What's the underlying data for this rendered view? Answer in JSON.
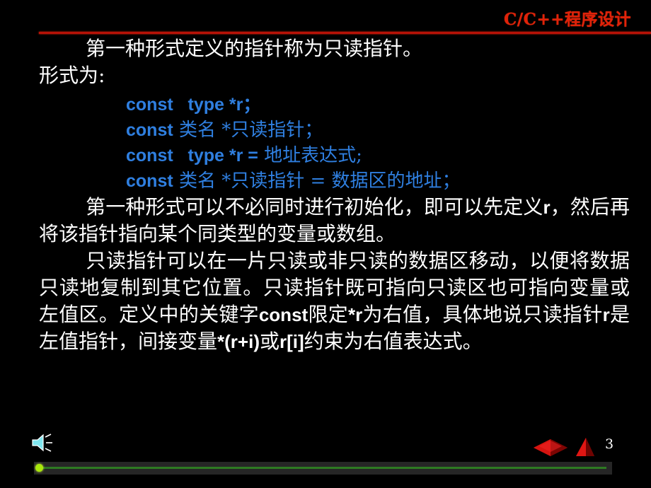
{
  "header": {
    "title": "C/C++程序设计",
    "accent_color": "#e02209",
    "rule_color": "#b81207"
  },
  "content": {
    "paragraph_1": "第一种形式定义的指针称为只读指针。",
    "label_form": "形式为:",
    "code": {
      "accent_color": "#2f7fe0",
      "lines": [
        {
          "keyword": "const",
          "type_kw": "type",
          "rest": " *r；",
          "id": "code-line-1",
          "full": "const   type  *r；"
        },
        {
          "keyword": "const",
          "type_kw": "",
          "rest": " 类名 *只读指针；",
          "id": "code-line-2",
          "full": "const 类名 *只读指针；"
        },
        {
          "keyword": "const",
          "type_kw": "type",
          "rest": " *r = 地址表达式;",
          "id": "code-line-3",
          "full": "const   type  *r = 地址表达式;"
        },
        {
          "keyword": "const",
          "type_kw": "",
          "rest": " 类名 *只读指针 = 数据区的地址；",
          "id": "code-line-4",
          "full": "const 类名 *只读指针 = 数据区的地址；"
        }
      ]
    },
    "paragraph_2_part1": "第一种形式可以不必同时进行初始化，即可以先定义",
    "paragraph_2_code": "r",
    "paragraph_2_part2": "，然后再将该指针指向某个同类型的变量或数组。",
    "paragraph_3_part1": "只读指针可以在一片只读或非只读的数据区移动，以便将数据只读地复制到其它位置。只读指针既可指向只读区也可指向变量或左值区。定义中的关键字",
    "paragraph_3_code1": "const",
    "paragraph_3_part2": "限定",
    "paragraph_3_code2": "*r",
    "paragraph_3_part3": "为右值，具体地说只读指针",
    "paragraph_3_code3": "r",
    "paragraph_3_part4": "是左值指针，间接变量",
    "paragraph_3_code4": "*(r+i)",
    "paragraph_3_part5": "或",
    "paragraph_3_code5": "r[i]",
    "paragraph_3_part6": "约束为右值表达式。"
  },
  "footer": {
    "page_number": "3",
    "sound_icon": "speaker-icon",
    "nav_prev_icon": "red-diamond-icon",
    "nav_next_icon": "red-triangle-icon",
    "progress_percent": 0,
    "progress_fill_color": "#2e7a22",
    "progress_knob_color": "#a9e80c"
  }
}
